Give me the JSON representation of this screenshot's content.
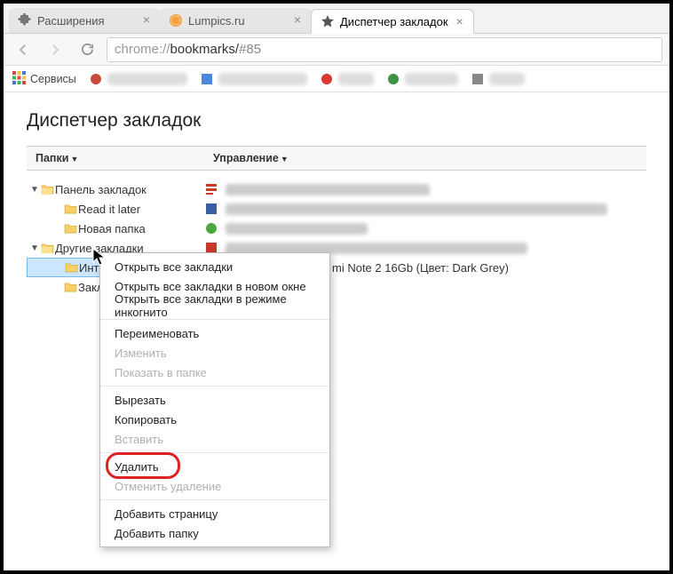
{
  "tabs": [
    {
      "label": "Расширения",
      "icon": "puzzle"
    },
    {
      "label": "Lumpics.ru",
      "icon": "orange"
    },
    {
      "label": "Диспетчер закладок",
      "icon": "star"
    }
  ],
  "omnibox": {
    "scheme": "chrome://",
    "path": "bookmarks/",
    "hash": "#85"
  },
  "bookmarkbar": {
    "services": "Сервисы"
  },
  "page": {
    "title": "Диспетчер закладок",
    "col_folders": "Папки",
    "col_manage": "Управление"
  },
  "tree": {
    "panel": "Панель закладок",
    "readit": "Read it later",
    "newfolder": "Новая папка",
    "other": "Другие закладки",
    "int": "Инт",
    "zakl": "Заклад"
  },
  "list": {
    "visible_item": "mi Note 2 16Gb (Цвет: Dark Grey)"
  },
  "menu": {
    "open_all": "Открыть все закладки",
    "open_all_new": "Открыть все закладки в новом окне",
    "open_all_incog": "Открыть все закладки в режиме инкогнито",
    "rename": "Переименовать",
    "edit": "Изменить",
    "show_in_folder": "Показать в папке",
    "cut": "Вырезать",
    "copy": "Копировать",
    "paste": "Вставить",
    "delete": "Удалить",
    "undo_delete": "Отменить удаление",
    "add_page": "Добавить страницу",
    "add_folder": "Добавить папку"
  }
}
